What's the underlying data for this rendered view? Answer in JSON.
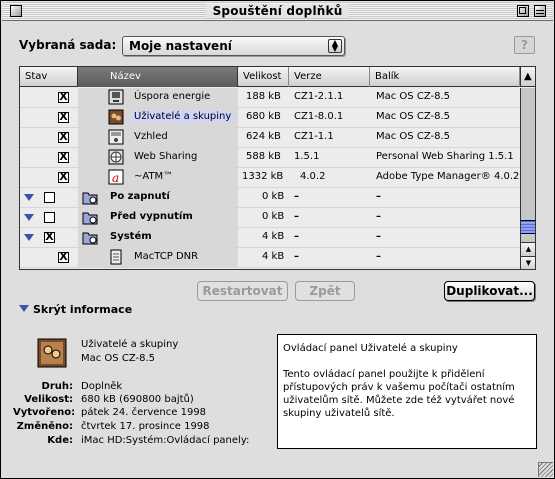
{
  "window": {
    "title": "Spouštění doplňků"
  },
  "set": {
    "label": "Vybraná sada:",
    "value": "Moje nastavení"
  },
  "help_label": "?",
  "columns": {
    "stav": "Stav",
    "nazev": "Název",
    "velikost": "Velikost",
    "verze": "Verze",
    "balik": "Balík"
  },
  "rows": [
    {
      "name": "Úspora energie",
      "size": "188 kB",
      "version": "CZ1-2.1.1",
      "package": "Mac OS CZ-8.5",
      "checked": "X"
    },
    {
      "name": "Uživatelé a skupiny",
      "size": "680 kB",
      "version": "CZ1-8.0.1",
      "package": "Mac OS CZ-8.5",
      "checked": "X"
    },
    {
      "name": "Vzhled",
      "size": "624 kB",
      "version": "CZ1-1.1",
      "package": "Mac OS CZ-8.5",
      "checked": "X"
    },
    {
      "name": "Web Sharing",
      "size": "588 kB",
      "version": "1.5.1",
      "package": "Personal Web Sharing 1.5.1",
      "checked": "X"
    },
    {
      "name": "~ATM™",
      "size": "1332 kB",
      "version": "4.0.2",
      "package": "Adobe Type Manager® 4.0.2",
      "checked": "X"
    },
    {
      "name": "Po zapnutí",
      "size": "0 kB",
      "version": "–",
      "package": "–",
      "checked": ""
    },
    {
      "name": "Před vypnutím",
      "size": "0 kB",
      "version": "–",
      "package": "–",
      "checked": ""
    },
    {
      "name": "Systém",
      "size": "4 kB",
      "version": "–",
      "package": "–",
      "checked": "X"
    },
    {
      "name": "MacTCP DNR",
      "size": "4 kB",
      "version": "–",
      "package": "–",
      "checked": "X"
    }
  ],
  "buttons": {
    "restart": "Restartovat",
    "revert": "Zpět",
    "duplicate": "Duplikovat..."
  },
  "info": {
    "toggle": "Skrýt informace",
    "item_name": "Uživatelé a skupiny",
    "item_package": "Mac OS CZ-8.5",
    "keys": {
      "kind": "Druh:",
      "size": "Velikost:",
      "created": "Vytvořeno:",
      "modified": "Změněno:",
      "where": "Kde:"
    },
    "kind": "Doplněk",
    "size": "680 kB (690800 bajtů)",
    "created": "pátek 24. července 1998",
    "modified": "čtvrtek 17. prosince 1998",
    "where": "iMac HD:Systém:Ovládací panely:",
    "desc_title": "Ovládací panel Uživatelé a skupiny",
    "desc_body": "Tento ovládací panel použijte k přidělení přístupových práv k vašemu počítači ostatním uživatelům sítě. Můžete zde též vytvářet nové skupiny uživatelů sítě."
  },
  "colors": {
    "accent": "#3857a8",
    "highlight": "#cfd4ff"
  },
  "icons": [
    "close-box",
    "zoom-box",
    "collapse-box",
    "energy-saver-icon",
    "users-groups-icon",
    "appearance-icon",
    "web-sharing-icon",
    "atm-icon",
    "folder-icon"
  ]
}
